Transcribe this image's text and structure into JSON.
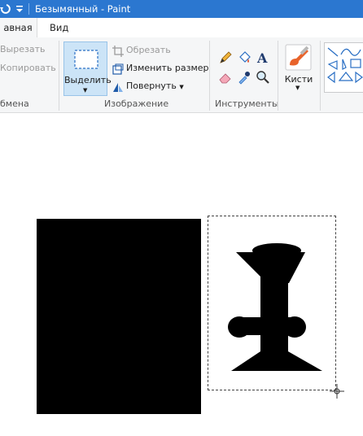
{
  "window": {
    "title": "Безымянный - Paint"
  },
  "tabs": {
    "home": "авная",
    "view": "Вид"
  },
  "clipboard": {
    "cut": "Вырезать",
    "copy": "Копировать",
    "group_label": "бмена"
  },
  "image": {
    "select_label": "Выделить",
    "crop": "Обрезать",
    "resize": "Изменить размер",
    "rotate": "Повернуть",
    "group_label": "Изображение"
  },
  "tools": {
    "group_label": "Инструменты"
  },
  "brushes": {
    "label": "Кисти"
  },
  "colors": {
    "title_bar": "#2b77d0",
    "selection_button": "#cce4f7",
    "ribbon": "#f5f6f7",
    "drawing": "#000000"
  }
}
